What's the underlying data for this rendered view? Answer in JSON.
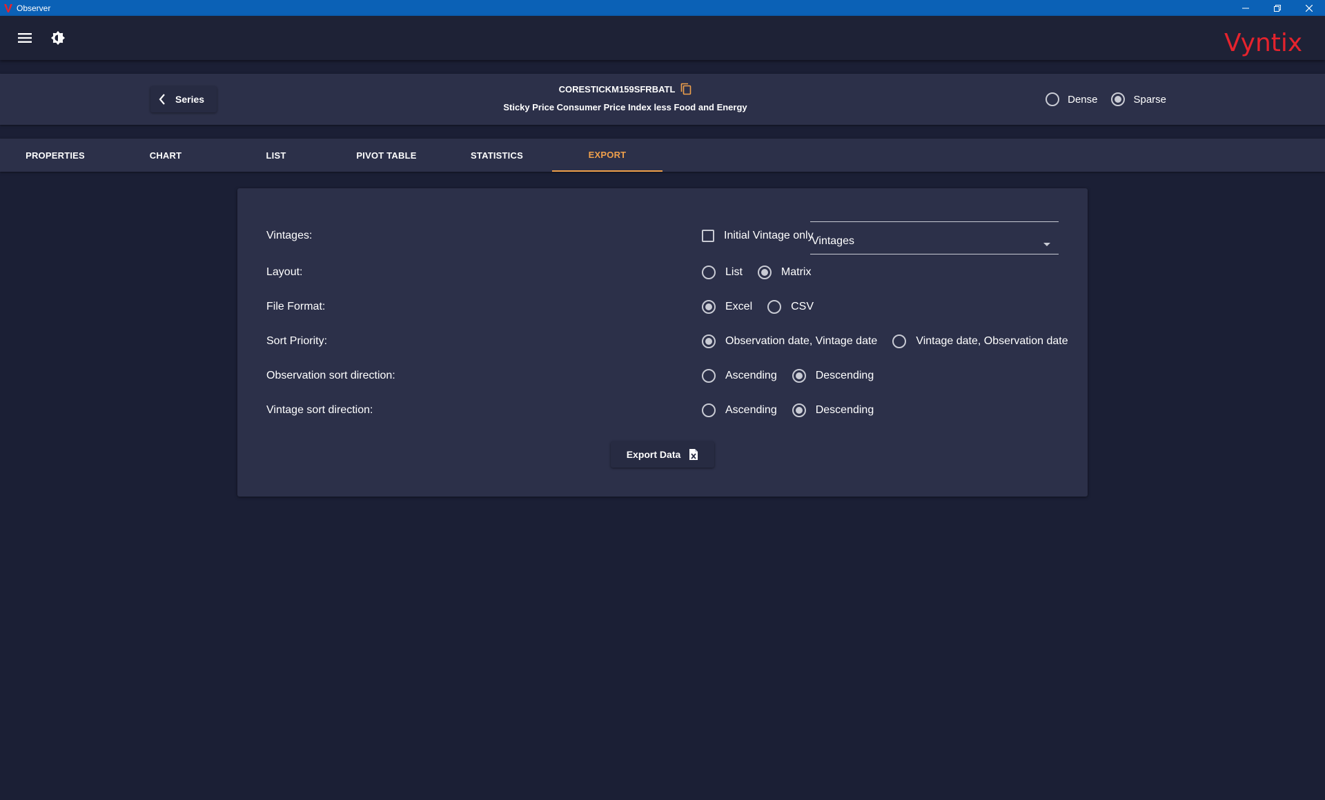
{
  "window": {
    "title": "Observer",
    "controls": [
      "minimize-icon",
      "restore-icon",
      "close-icon"
    ]
  },
  "appbar": {
    "menu_icon": "hamburger-menu-icon",
    "theme_icon": "brightness-icon",
    "logo_text": "Vyntix",
    "logo_color": "#e5232d"
  },
  "series": {
    "back_label": "Series",
    "id": "CORESTICKM159SFRBATL",
    "title": "Sticky Price Consumer Price Index less Food and Energy",
    "copy_icon_color": "#f0a04b",
    "density_options": [
      {
        "label": "Dense",
        "checked": false
      },
      {
        "label": "Sparse",
        "checked": true
      }
    ]
  },
  "tabs": [
    {
      "label": "PROPERTIES",
      "active": false
    },
    {
      "label": "CHART",
      "active": false
    },
    {
      "label": "LIST",
      "active": false
    },
    {
      "label": "PIVOT TABLE",
      "active": false
    },
    {
      "label": "STATISTICS",
      "active": false
    },
    {
      "label": "EXPORT",
      "active": true
    }
  ],
  "accent_color": "#f0a04b",
  "export": {
    "vintages": {
      "label": "Vintages:",
      "checkbox_label": "Initial Vintage only",
      "checkbox_checked": false,
      "select_value": "Vintages"
    },
    "layout": {
      "label": "Layout:",
      "options": [
        {
          "label": "List",
          "checked": false
        },
        {
          "label": "Matrix",
          "checked": true
        }
      ]
    },
    "file_format": {
      "label": "File Format:",
      "options": [
        {
          "label": "Excel",
          "checked": true
        },
        {
          "label": "CSV",
          "checked": false
        }
      ]
    },
    "sort_priority": {
      "label": "Sort Priority:",
      "options": [
        {
          "label": "Observation date, Vintage date",
          "checked": true
        },
        {
          "label": "Vintage date, Observation date",
          "checked": false
        }
      ]
    },
    "observation_sort": {
      "label": "Observation sort direction:",
      "options": [
        {
          "label": "Ascending",
          "checked": false
        },
        {
          "label": "Descending",
          "checked": true
        }
      ]
    },
    "vintage_sort": {
      "label": "Vintage sort direction:",
      "options": [
        {
          "label": "Ascending",
          "checked": false
        },
        {
          "label": "Descending",
          "checked": true
        }
      ]
    },
    "export_button_label": "Export Data",
    "export_button_icon": "excel-file-icon"
  }
}
